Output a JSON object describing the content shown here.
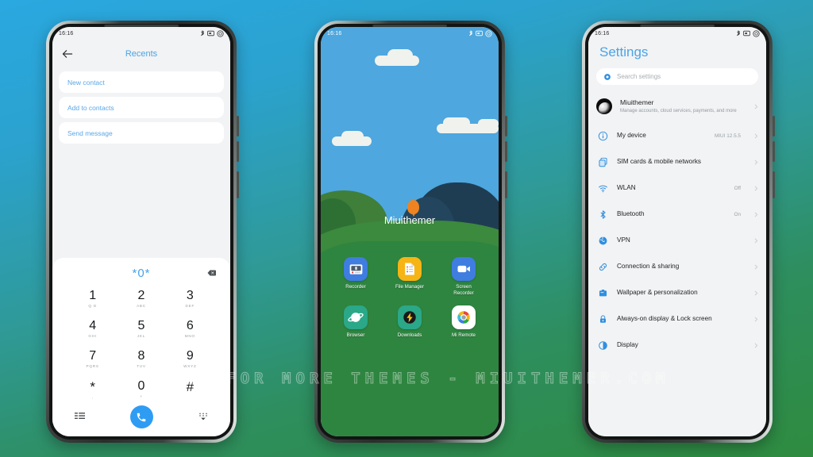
{
  "watermark": "VISIT FOR MORE THEMES - MIUITHEMER.COM",
  "status_bar": {
    "time": "16:16",
    "icons": [
      "bluetooth-icon",
      "sim-icon",
      "battery-icon"
    ]
  },
  "phone1": {
    "app": "Dialer",
    "header": {
      "back": "back-arrow-icon",
      "title": "Recents"
    },
    "actions": [
      {
        "label": "New contact"
      },
      {
        "label": "Add to contacts"
      },
      {
        "label": "Send message"
      }
    ],
    "dialpad": {
      "display": "*0*",
      "backspace": "backspace-icon",
      "keys": [
        {
          "num": "1",
          "sub": "Q D"
        },
        {
          "num": "2",
          "sub": "ABC"
        },
        {
          "num": "3",
          "sub": "DEF"
        },
        {
          "num": "4",
          "sub": "GHI"
        },
        {
          "num": "5",
          "sub": "JKL"
        },
        {
          "num": "6",
          "sub": "MNO"
        },
        {
          "num": "7",
          "sub": "PQRS"
        },
        {
          "num": "8",
          "sub": "TUV"
        },
        {
          "num": "9",
          "sub": "WXYZ"
        },
        {
          "num": "*",
          "sub": ","
        },
        {
          "num": "0",
          "sub": "+"
        },
        {
          "num": "#",
          "sub": ""
        }
      ],
      "bottom": {
        "left_icon": "contacts-list-icon",
        "call_icon": "phone-call-icon",
        "right_icon": "hide-keypad-icon"
      }
    }
  },
  "phone2": {
    "app": "Home screen",
    "wallpaper_label": "Miuithemer",
    "apps": [
      {
        "label": "Recorder",
        "icon": "recorder-icon"
      },
      {
        "label": "File Manager",
        "icon": "file-manager-icon"
      },
      {
        "label": "Screen Recorder",
        "icon": "screen-recorder-icon"
      },
      {
        "label": "Browser",
        "icon": "browser-icon"
      },
      {
        "label": "Downloads",
        "icon": "downloads-icon"
      },
      {
        "label": "Mi Remote",
        "icon": "mi-remote-icon"
      }
    ]
  },
  "phone3": {
    "app": "Settings",
    "title": "Settings",
    "search": {
      "placeholder": "Search settings",
      "icon": "search-icon"
    },
    "account": {
      "name": "Miuithemer",
      "subtitle": "Manage accounts, cloud services, payments, and more",
      "avatar": "avatar"
    },
    "rows": [
      {
        "label": "My device",
        "value": "MIUI 12.5.5",
        "icon": "info-icon"
      },
      {
        "label": "SIM cards & mobile networks",
        "value": "",
        "icon": "sim-cards-icon"
      },
      {
        "label": "WLAN",
        "value": "Off",
        "icon": "wifi-icon"
      },
      {
        "label": "Bluetooth",
        "value": "On",
        "icon": "bluetooth-icon"
      },
      {
        "label": "VPN",
        "value": "",
        "icon": "vpn-globe-icon"
      },
      {
        "label": "Connection & sharing",
        "value": "",
        "icon": "link-icon"
      },
      {
        "label": "Wallpaper & personalization",
        "value": "",
        "icon": "wallpaper-icon"
      },
      {
        "label": "Always-on display & Lock screen",
        "value": "",
        "icon": "lock-icon"
      },
      {
        "label": "Display",
        "value": "",
        "icon": "display-icon"
      }
    ]
  },
  "colors": {
    "accent_blue": "#4aa3e8",
    "call_green_bg": "#2f9cf4",
    "bg_gradient_top": "#2aa8e0",
    "bg_gradient_bottom": "#2e8b3f"
  }
}
